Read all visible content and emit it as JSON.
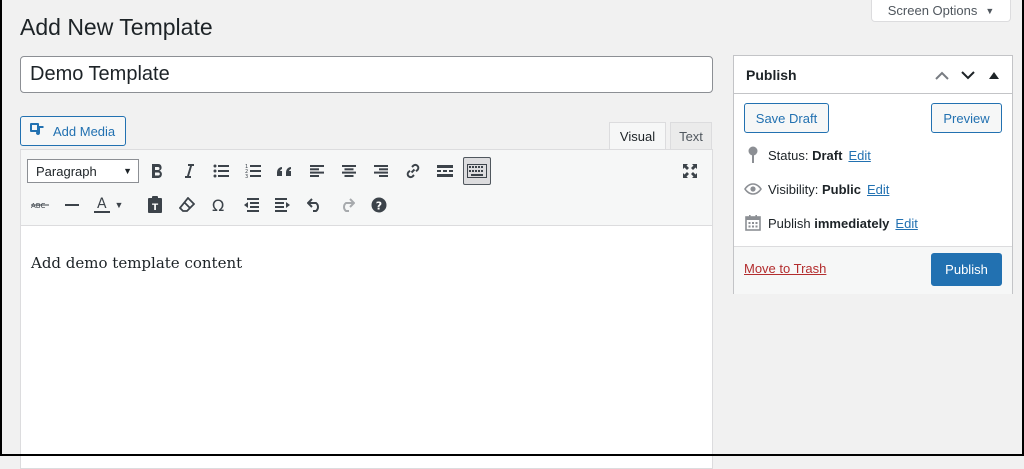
{
  "header": {
    "title": "Add New Template",
    "screen_options": "Screen Options"
  },
  "editor": {
    "title_value": "Demo Template",
    "add_media": "Add Media",
    "tabs": [
      "Visual",
      "Text"
    ],
    "format_select": "Paragraph",
    "content": "Add demo template content"
  },
  "publish": {
    "title": "Publish",
    "save_draft": "Save Draft",
    "preview": "Preview",
    "status_label": "Status:",
    "status_value": "Draft",
    "visibility_label": "Visibility:",
    "visibility_value": "Public",
    "schedule_label": "Publish",
    "schedule_value": "immediately",
    "edit": "Edit",
    "move_to_trash": "Move to Trash",
    "publish_button": "Publish"
  },
  "colors": {
    "accent": "#2271b1",
    "danger": "#b32d2e",
    "background": "#f1f1f1"
  }
}
